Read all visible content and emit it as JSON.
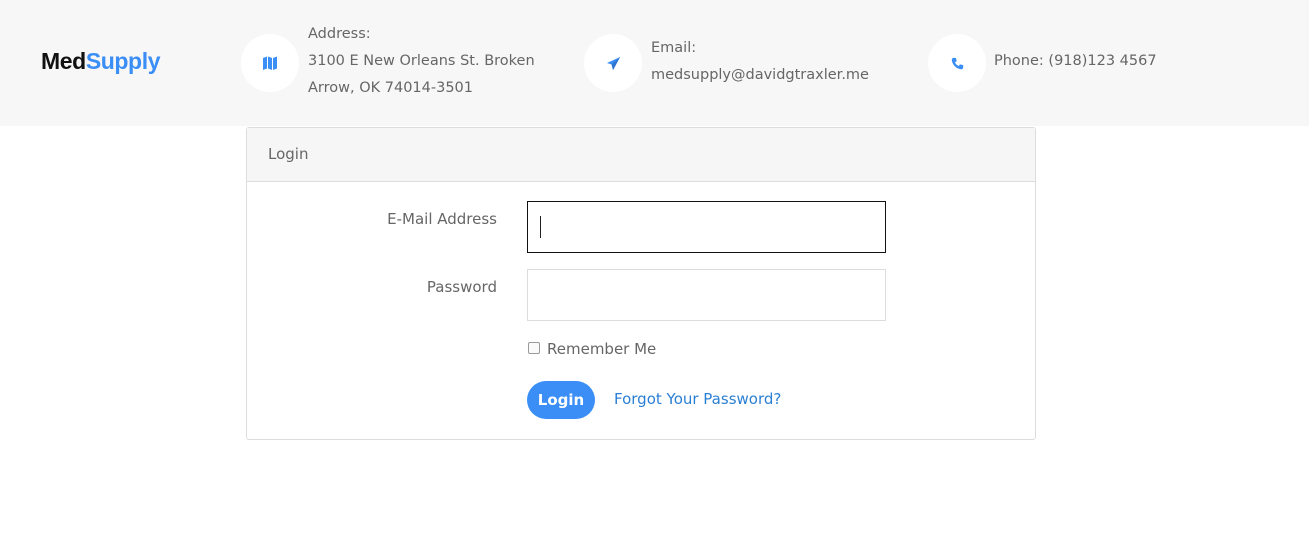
{
  "brand": {
    "part1": "Med",
    "part2": "Supply",
    "accent_color": "#3a8ef6"
  },
  "header": {
    "address": {
      "icon": "map-icon",
      "label": "Address:",
      "line1": "3100 E New Orleans St. Broken",
      "line2": "Arrow, OK 74014-3501"
    },
    "email": {
      "icon": "paper-plane-icon",
      "label": "Email:",
      "value": "medsupply@davidgtraxler.me"
    },
    "phone": {
      "icon": "phone-icon",
      "text": "Phone: (918)123 4567"
    }
  },
  "login_card": {
    "title": "Login",
    "email_label": "E-Mail Address",
    "email_value": "",
    "password_label": "Password",
    "password_value": "",
    "remember_label": "Remember Me",
    "remember_checked": false,
    "submit_label": "Login",
    "forgot_label": "Forgot Your Password?"
  }
}
